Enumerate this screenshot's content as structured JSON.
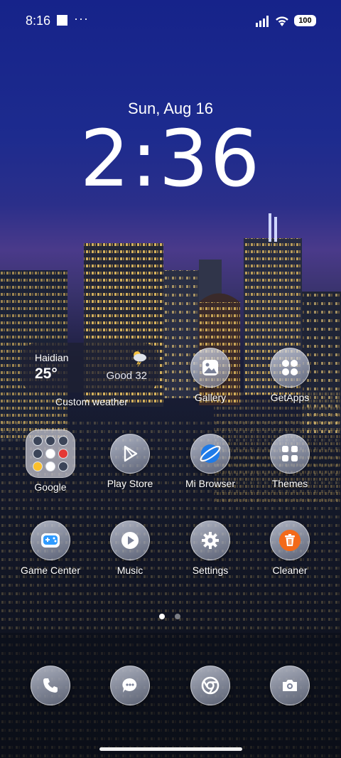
{
  "status_bar": {
    "time": "8:16",
    "overflow": "···",
    "battery": "100"
  },
  "lockclock": {
    "date": "Sun, Aug 16",
    "time": "2:36"
  },
  "weather_widget": {
    "city": "Haidian",
    "temperature": "25°",
    "air_quality": "Good 32",
    "condition_icon": "thunderstorm-icon",
    "label": "Custom weather"
  },
  "apps": [
    {
      "label": "Gallery",
      "icon": "gallery-icon"
    },
    {
      "label": "GetApps",
      "icon": "getapps-icon"
    },
    {
      "label": "Google",
      "icon": "folder-icon"
    },
    {
      "label": "Play Store",
      "icon": "play-store-icon"
    },
    {
      "label": "Mi Browser",
      "icon": "browser-icon"
    },
    {
      "label": "Themes",
      "icon": "themes-icon"
    },
    {
      "label": "Game Center",
      "icon": "gamepad-icon"
    },
    {
      "label": "Music",
      "icon": "music-icon"
    },
    {
      "label": "Settings",
      "icon": "gear-icon"
    },
    {
      "label": "Cleaner",
      "icon": "trash-icon"
    }
  ],
  "dock": [
    {
      "icon": "phone-icon"
    },
    {
      "icon": "messages-icon"
    },
    {
      "icon": "chrome-icon"
    },
    {
      "icon": "camera-icon"
    }
  ],
  "pager": {
    "pages": 2,
    "current": 1
  },
  "colors": {
    "cleaner_orange": "#f36a1a",
    "browser_blue": "#1f7be8",
    "gamecenter_blue": "#2f9bff"
  }
}
